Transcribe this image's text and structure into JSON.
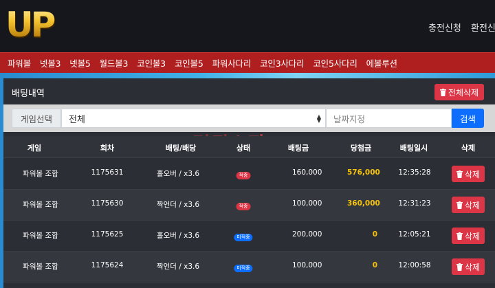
{
  "header": {
    "logo_text": "UP",
    "links": [
      "충전신청",
      "환전신"
    ]
  },
  "nav": {
    "items": [
      "파워볼",
      "넷볼3",
      "넷볼5",
      "월드볼3",
      "코인볼3",
      "코인볼5",
      "파워사다리",
      "코인3사다리",
      "코인5사다리",
      "에볼루션"
    ]
  },
  "panel": {
    "title": "배팅내역",
    "delete_all_label": "전체삭제"
  },
  "filter": {
    "game_label": "게임선택",
    "game_selected": "전체",
    "date_placeholder": "날짜지정",
    "search_label": "검색"
  },
  "watermark": {
    "part1": "먹튀",
    "part2": "스팟"
  },
  "table": {
    "headers": [
      "게임",
      "회차",
      "배팅/배당",
      "상태",
      "배팅금",
      "당첨금",
      "배팅일시",
      "삭제"
    ],
    "rows": [
      {
        "game": "파워볼 조합",
        "round": "1175631",
        "bet": "홀오버 / x3.6",
        "status": "적중",
        "status_type": "lose",
        "amount": "160,000",
        "win": "576,000",
        "time": "12:35:28",
        "delete": "삭제"
      },
      {
        "game": "파워볼 조합",
        "round": "1175630",
        "bet": "짝언더 / x3.6",
        "status": "적중",
        "status_type": "lose",
        "amount": "100,000",
        "win": "360,000",
        "time": "12:31:23",
        "delete": "삭제"
      },
      {
        "game": "파워볼 조합",
        "round": "1175625",
        "bet": "홀오버 / x3.6",
        "status": "미적중",
        "status_type": "pending",
        "amount": "200,000",
        "win": "0",
        "time": "12:05:21",
        "delete": "삭제"
      },
      {
        "game": "파워볼 조합",
        "round": "1175624",
        "bet": "짝언더 / x3.6",
        "status": "미적중",
        "status_type": "pending",
        "amount": "100,000",
        "win": "0",
        "time": "12:00:58",
        "delete": "삭제"
      }
    ]
  },
  "colors": {
    "nav_red": "#b01f1f",
    "danger": "#dc3545",
    "primary": "#0d6efd",
    "gold": "#f5c20a",
    "panel": "#2b2e35"
  },
  "icons": {
    "delete": "trash-icon",
    "select": "select-caret-icon"
  }
}
